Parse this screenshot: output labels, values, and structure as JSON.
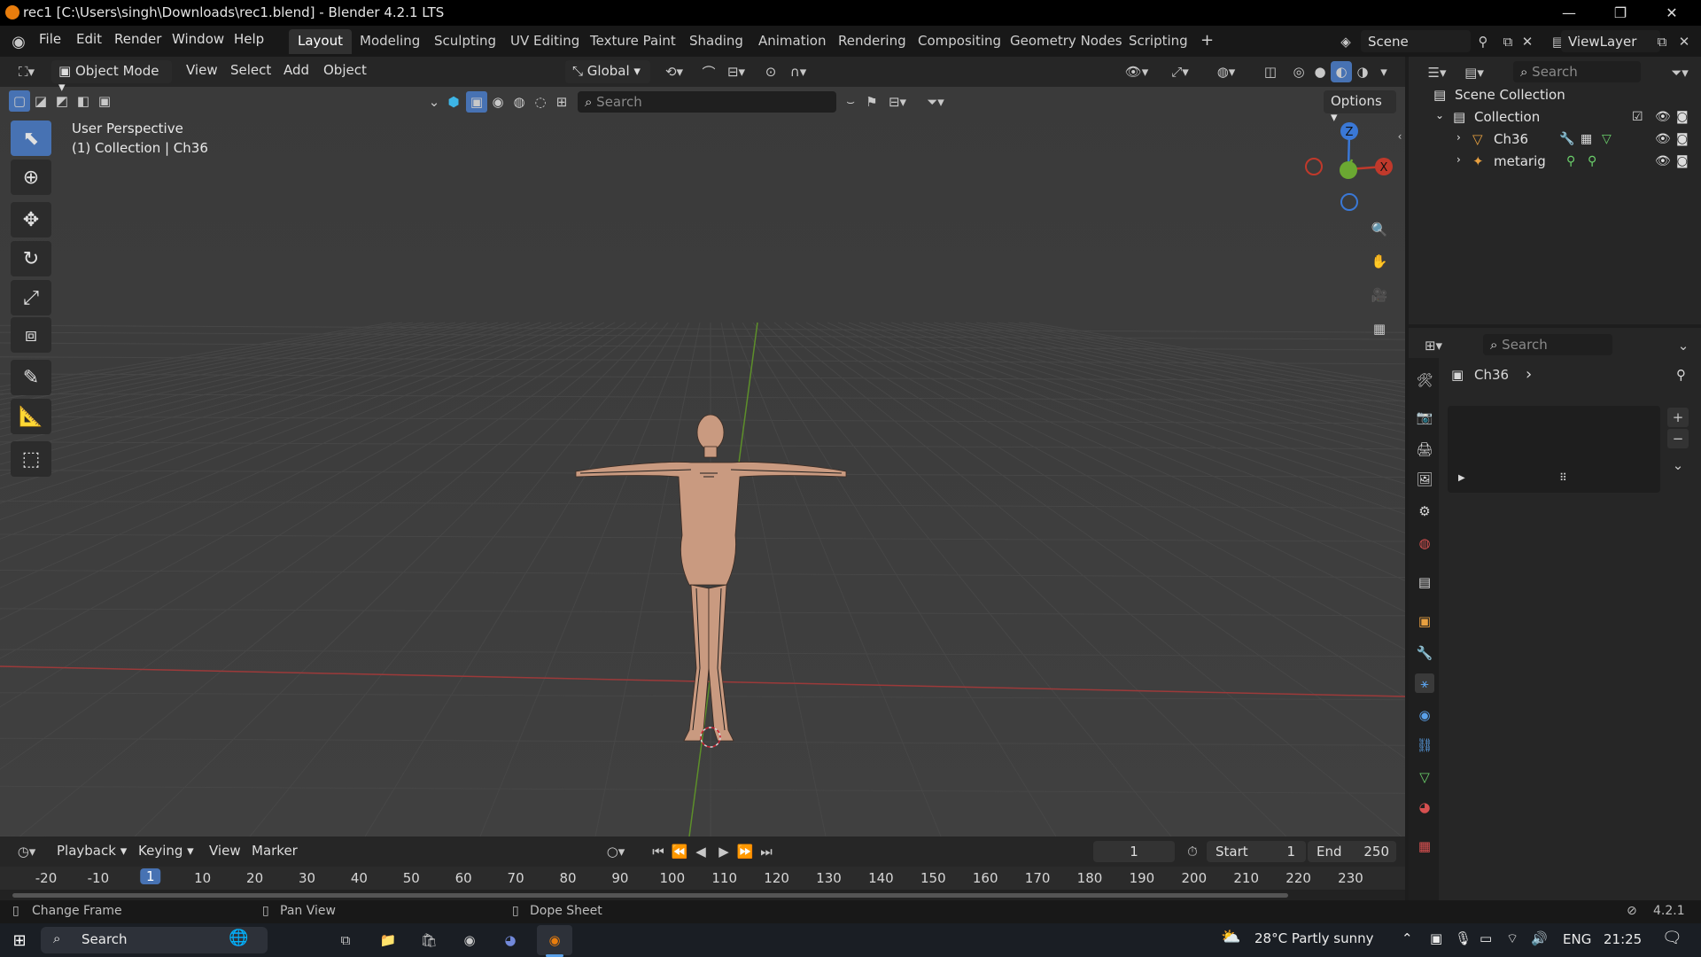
{
  "titlebar": {
    "title": "rec1 [C:\\Users\\singh\\Downloads\\rec1.blend] - Blender 4.2.1 LTS",
    "minimize": "—",
    "maximize": "❐",
    "close": "✕"
  },
  "menubar": {
    "menus": [
      "File",
      "Edit",
      "Render",
      "Window",
      "Help"
    ],
    "workspaces": [
      "Layout",
      "Modeling",
      "Sculpting",
      "UV Editing",
      "Texture Paint",
      "Shading",
      "Animation",
      "Rendering",
      "Compositing",
      "Geometry Nodes",
      "Scripting"
    ],
    "active_workspace": "Layout",
    "add_workspace": "+",
    "scene": "Scene",
    "view_layer": "ViewLayer"
  },
  "viewport_header": {
    "mode": "Object Mode",
    "menus": [
      "View",
      "Select",
      "Add",
      "Object"
    ],
    "orientation": "Global",
    "search_placeholder": "Search",
    "options": "Options"
  },
  "viewport": {
    "perspective": "User Perspective",
    "collection_info": "(1) Collection | Ch36",
    "gizmo": {
      "z": "Z",
      "x": "X",
      "y": "Y"
    }
  },
  "outliner": {
    "search_placeholder": "Search",
    "scene_collection": "Scene Collection",
    "collection": "Collection",
    "items": [
      "Ch36",
      "metarig"
    ]
  },
  "properties": {
    "search_placeholder": "Search",
    "object_name": "Ch36",
    "chevron": "›"
  },
  "timeline": {
    "menus": [
      "Playback",
      "Keying",
      "View",
      "Marker"
    ],
    "current_frame": "1",
    "start_label": "Start",
    "start_value": "1",
    "end_label": "End",
    "end_value": "250",
    "ticks": [
      "-20",
      "-10",
      "1",
      "10",
      "20",
      "30",
      "40",
      "50",
      "60",
      "70",
      "80",
      "90",
      "100",
      "110",
      "120",
      "130",
      "140",
      "150",
      "160",
      "170",
      "180",
      "190",
      "200",
      "210",
      "220",
      "230"
    ]
  },
  "statusbar": {
    "hints": [
      "Change Frame",
      "Pan View",
      "Dope Sheet"
    ],
    "version": "4.2.1"
  },
  "taskbar": {
    "search": "Search",
    "weather": "28°C Partly sunny",
    "language": "ENG",
    "time": "21:25"
  },
  "colors": {
    "accent": "#4772b3",
    "viewport_bg": "#3d3d3d",
    "x_axis": "#c0392b",
    "y_axis": "#6ba832",
    "z_axis": "#3a78d6"
  }
}
